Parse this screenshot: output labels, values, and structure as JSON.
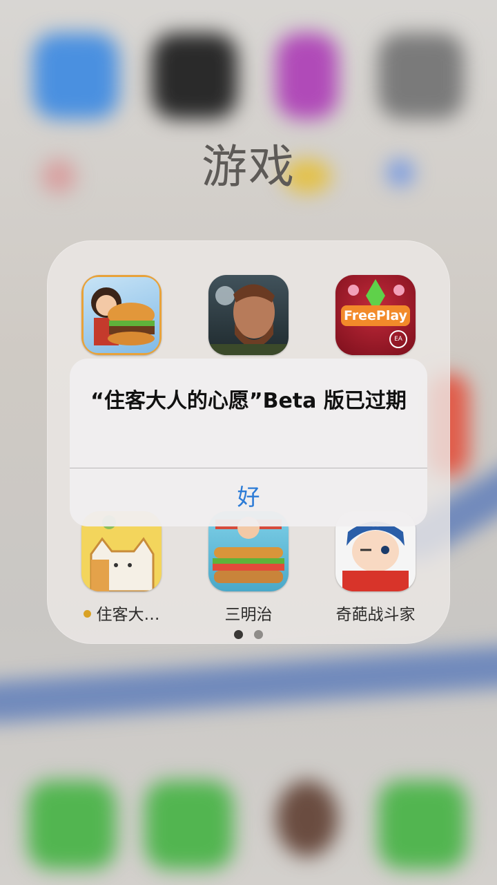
{
  "folder": {
    "title": "游戏",
    "apps": [
      {
        "name": "",
        "icon": "burger-chef-game-icon"
      },
      {
        "name": "",
        "icon": "bearded-man-game-icon"
      },
      {
        "name": "",
        "icon": "sims-freeplay-icon",
        "icon_text": "FreePlay",
        "badge_text": "EA"
      },
      {
        "name": "住客大…",
        "icon": "cat-game-icon",
        "beta_dot": true
      },
      {
        "name": "三明治",
        "icon": "sandwich-chef-game-icon"
      },
      {
        "name": "奇葩战斗家",
        "icon": "anime-boy-game-icon"
      }
    ],
    "page_dots": 2,
    "current_page": 1
  },
  "alert": {
    "message": "“住客大人的心愿”Beta 版已过期",
    "ok_label": "好"
  },
  "colors": {
    "accent": "#2c7bd6",
    "beta_dot": "#d9a225"
  }
}
